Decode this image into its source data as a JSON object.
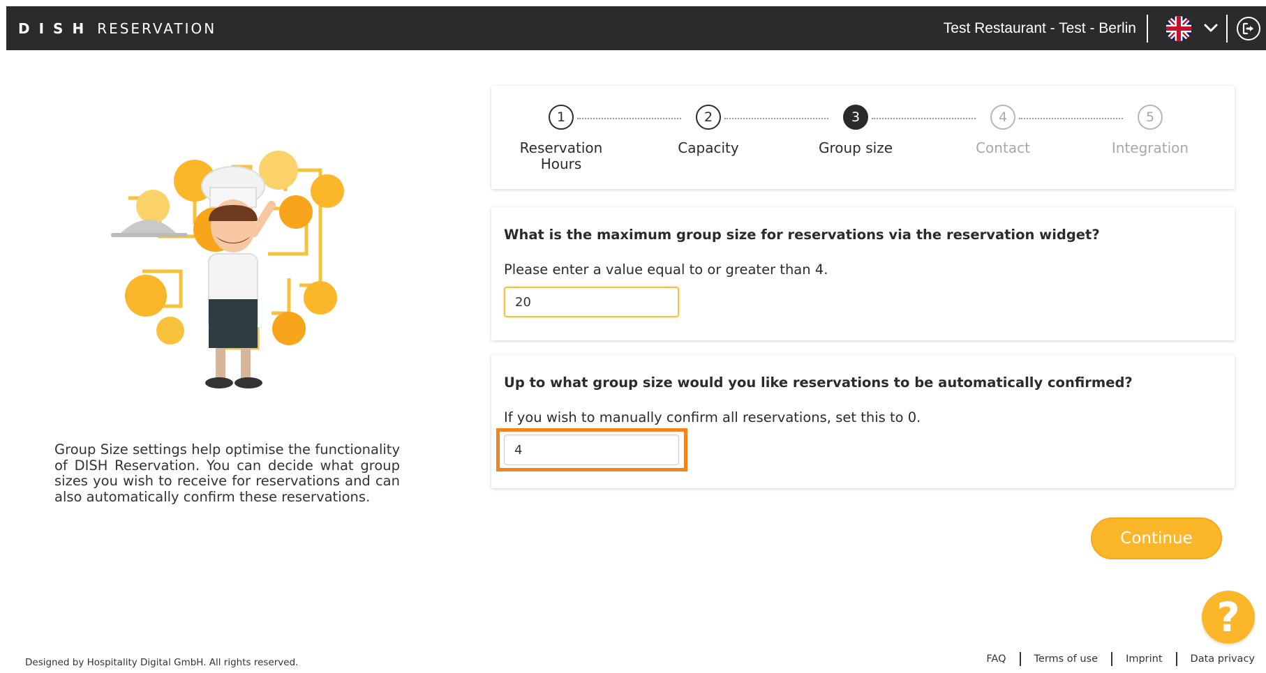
{
  "header": {
    "brand_dish": "DISH",
    "brand_reservation": "RESERVATION",
    "restaurant": "Test Restaurant - Test - Berlin",
    "language_icon": "uk-flag-icon",
    "language_chevron_icon": "chevron-down-icon",
    "logout_icon": "logout-icon"
  },
  "steps": [
    {
      "number": "1",
      "label": "Reservation Hours",
      "state": "done"
    },
    {
      "number": "2",
      "label": "Capacity",
      "state": "done"
    },
    {
      "number": "3",
      "label": "Group size",
      "state": "active"
    },
    {
      "number": "4",
      "label": "Contact",
      "state": "future"
    },
    {
      "number": "5",
      "label": "Integration",
      "state": "future"
    }
  ],
  "questions": {
    "max_group": {
      "title": "What is the maximum group size for reservations via the reservation widget?",
      "hint": "Please enter a value equal to or greater than 4.",
      "value": "20"
    },
    "auto_confirm": {
      "title": "Up to what group size would you like reservations to be automatically confirmed?",
      "hint": "If you wish to manually confirm all reservations, set this to 0.",
      "value": "4"
    }
  },
  "left_panel": {
    "description": "Group Size settings help optimise the functionality of DISH Reservation. You can decide what group sizes you wish to receive for reservations and can also automatically confirm these reservations.",
    "illustration_icon": "chef-illustration"
  },
  "actions": {
    "continue_label": "Continue",
    "help_label": "?"
  },
  "footer": {
    "copyright": "Designed by Hospitality Digital GmbH. All rights reserved.",
    "links": [
      "FAQ",
      "Terms of use",
      "Imprint",
      "Data privacy"
    ]
  },
  "colors": {
    "topbar": "#2b2b2b",
    "accent": "#fbb62a",
    "highlight": "#f5841f"
  }
}
